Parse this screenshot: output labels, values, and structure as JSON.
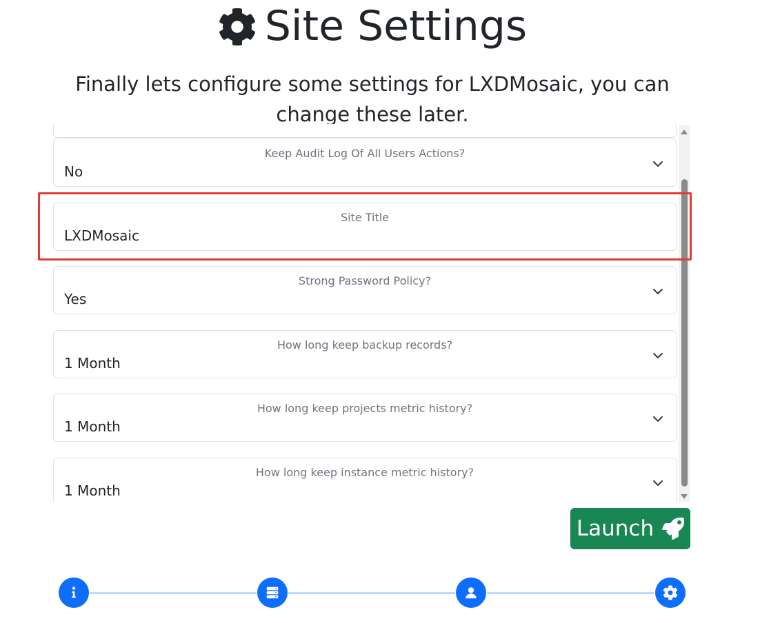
{
  "header": {
    "title": "Site Settings",
    "title_icon": "gear-icon",
    "subtitle": "Finally lets configure some settings for LXDMosaic, you can change these later."
  },
  "settings": [
    {
      "label": "Keep Audit Log Of All Users Actions?",
      "value": "No",
      "type": "select"
    },
    {
      "label": "Site Title",
      "value": "LXDMosaic",
      "type": "text"
    },
    {
      "label": "Strong Password Policy?",
      "value": "Yes",
      "type": "select"
    },
    {
      "label": "How long keep backup records?",
      "value": "1 Month",
      "type": "select"
    },
    {
      "label": "How long keep projects metric history?",
      "value": "1 Month",
      "type": "select"
    },
    {
      "label": "How long keep instance metric history?",
      "value": "1 Month",
      "type": "select"
    }
  ],
  "launch": {
    "label": "Launch",
    "icon": "rocket-icon"
  },
  "steps": [
    {
      "icon": "info-icon"
    },
    {
      "icon": "server-icon"
    },
    {
      "icon": "user-icon"
    },
    {
      "icon": "gear-icon"
    }
  ],
  "colors": {
    "primary": "#0d6efd",
    "success": "#198754",
    "highlight": "#e53935",
    "muted": "#6c757d"
  }
}
